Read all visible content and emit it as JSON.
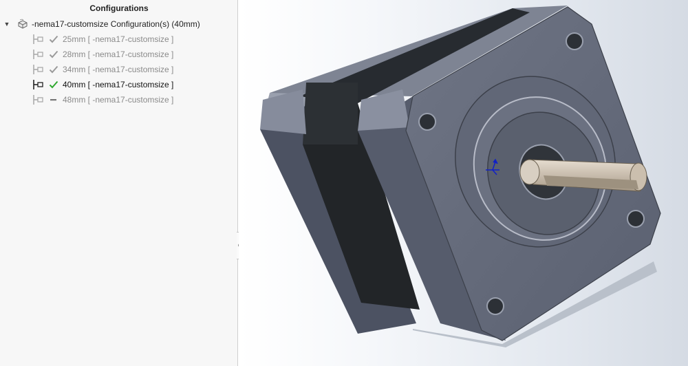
{
  "panel": {
    "title": "Configurations",
    "root_label": "-nema17-customsize Configuration(s)  (40mm)",
    "configurations": [
      {
        "label": "25mm [ -nema17-customsize ]",
        "state": "check",
        "active": false
      },
      {
        "label": "28mm [ -nema17-customsize ]",
        "state": "check",
        "active": false
      },
      {
        "label": "34mm [ -nema17-customsize ]",
        "state": "check",
        "active": false
      },
      {
        "label": "40mm [ -nema17-customsize ]",
        "state": "check-green",
        "active": true
      },
      {
        "label": "48mm [ -nema17-customsize ]",
        "state": "dash",
        "active": false
      }
    ]
  },
  "colors": {
    "active_check": "#2ea82e",
    "inactive_text": "#8a8a8a",
    "triad": "#1020c8"
  },
  "icons": {
    "expander": "triangle-down-icon",
    "part": "part-icon",
    "configuration": "configuration-icon",
    "check": "check-icon",
    "dash": "dash-icon"
  }
}
